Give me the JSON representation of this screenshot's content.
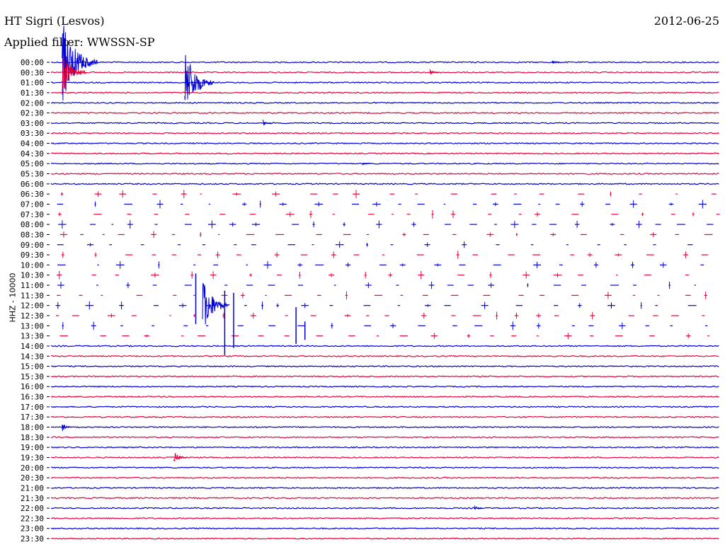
{
  "header": {
    "station": "HT Sigri (Lesvos)",
    "filter": "Applied filter: WWSSN-SP",
    "date": "2012-06-25",
    "channel": "HHZ - 10000"
  },
  "colors": {
    "odd": "#0000d6",
    "even": "#e8003a"
  },
  "chart_data": {
    "type": "line",
    "title": "HT Sigri (Lesvos)",
    "subtitle": "Applied filter: WWSSN-SP",
    "ylabel": "HHZ - 10000",
    "xlabel": "",
    "row_labels": [
      "00:00",
      "00:30",
      "01:00",
      "01:30",
      "02:00",
      "02:30",
      "03:00",
      "03:30",
      "04:00",
      "04:30",
      "05:00",
      "05:30",
      "06:00",
      "06:30",
      "07:00",
      "07:30",
      "08:00",
      "08:30",
      "09:00",
      "09:30",
      "10:00",
      "10:30",
      "11:00",
      "11:30",
      "12:00",
      "12:30",
      "13:00",
      "13:30",
      "14:00",
      "14:30",
      "15:00",
      "15:30",
      "16:00",
      "16:30",
      "17:00",
      "17:30",
      "18:00",
      "18:30",
      "19:00",
      "19:30",
      "20:00",
      "20:30",
      "21:00",
      "21:30",
      "22:00",
      "22:30",
      "23:00",
      "23:30"
    ],
    "row_colors": [
      "blue",
      "red",
      "blue",
      "red",
      "blue",
      "red",
      "blue",
      "red",
      "blue",
      "red",
      "blue",
      "red",
      "blue",
      "red",
      "blue",
      "red",
      "blue",
      "red",
      "blue",
      "red",
      "blue",
      "red",
      "blue",
      "red",
      "blue",
      "red",
      "blue",
      "red",
      "blue",
      "red",
      "blue",
      "red",
      "blue",
      "red",
      "blue",
      "red",
      "blue",
      "red",
      "blue",
      "red",
      "blue",
      "red",
      "blue",
      "red",
      "blue",
      "red",
      "blue",
      "red"
    ],
    "gap_rows": [
      "06:30",
      "07:00",
      "07:30",
      "08:00",
      "08:30",
      "09:00",
      "09:30",
      "10:00",
      "10:30",
      "11:00",
      "11:30",
      "12:00",
      "12:30",
      "13:00",
      "13:30"
    ],
    "events": [
      {
        "row": "00:00",
        "minute": 0.5,
        "amplitude": 5.0
      },
      {
        "row": "00:00",
        "minute": 22.5,
        "amplitude": 0.3
      },
      {
        "row": "00:30",
        "minute": 0.5,
        "amplitude": 3.0
      },
      {
        "row": "00:30",
        "minute": 17.0,
        "amplitude": 0.4
      },
      {
        "row": "01:00",
        "minute": 6.0,
        "amplitude": 4.0
      },
      {
        "row": "03:00",
        "minute": 9.5,
        "amplitude": 0.4
      },
      {
        "row": "05:00",
        "minute": 14.0,
        "amplitude": 0.2
      },
      {
        "row": "12:00",
        "minute": 6.8,
        "amplitude": 3.5
      },
      {
        "row": "18:00",
        "minute": 0.5,
        "amplitude": 0.5
      },
      {
        "row": "19:30",
        "minute": 5.5,
        "amplitude": 1.0
      },
      {
        "row": "22:00",
        "minute": 19.0,
        "amplitude": 0.3
      }
    ],
    "grid": false
  }
}
